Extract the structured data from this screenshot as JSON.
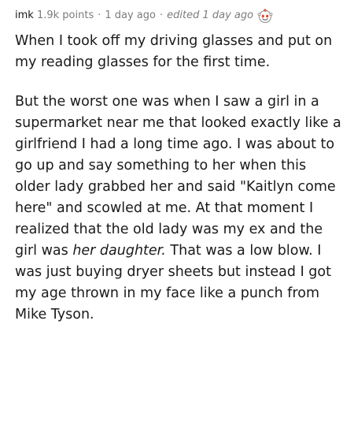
{
  "comment": {
    "username": "imk",
    "points": "1.9k points",
    "separator": "·",
    "age": "1 day ago",
    "edited": "edited 1 day ago",
    "award_icon": "wholesome-award-icon",
    "paragraph1": "When I took off my driving glasses and put on my reading glasses for the first time.",
    "paragraph2_before_italic": "But the worst one was when I saw a girl in a supermarket near me that looked exactly like a girlfriend I had a long time ago. I was about to go up and say something to her when this older lady grabbed her and said \"Kaitlyn come here\" and scowled at me. At that moment I realized that the old lady was my ex and the girl was ",
    "paragraph2_italic": "her daughter.",
    "paragraph2_after_italic": " That was a low blow. I was just buying dryer sheets but instead I got my age thrown in my face like a punch from Mike Tyson."
  }
}
